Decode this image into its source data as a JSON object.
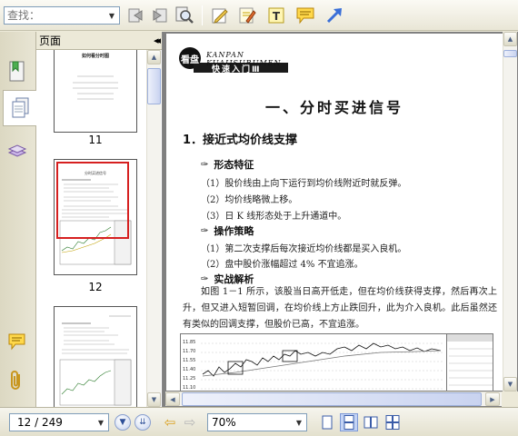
{
  "toolbar": {
    "find_placeholder": "查找：",
    "icons": [
      "prev-find-icon",
      "next-find-icon",
      "zoom-search-icon",
      "pencil-tool-icon",
      "highlight-tool-icon",
      "text-tool-icon",
      "note-tool-icon",
      "arrow-tool-icon"
    ]
  },
  "sidebar": {
    "panel_title": "页面",
    "collapse_glyph": "◂◂",
    "tabs": [
      "pages-tab",
      "bookmarks-tab",
      "layers-tab",
      "comments-tab",
      "attachments-tab"
    ],
    "thumbnails": [
      {
        "label": "11",
        "heading": "如何看分时图"
      },
      {
        "label": "12",
        "heading": "分时买进信号",
        "selected": true
      },
      {
        "label": "",
        "heading": ""
      }
    ]
  },
  "document": {
    "logo_sub": "KANPAN KUAIJSURUMEN",
    "logo_main": "快速入门Ⅲ",
    "logo_mark": "看盘",
    "title": "一、分时买进信号",
    "section": "1．接近式均价线支撑",
    "sub1": "形态特征",
    "lines1": [
      "（1）股价线由上向下运行到均价线附近时就反弹。",
      "（2）均价线略微上移。",
      "（3）日 K 线形态处于上升通道中。"
    ],
    "sub2": "操作策略",
    "lines2": [
      "（1）第二次支撑后每次接近均价线都是买入良机。",
      "（2）盘中股价涨幅超过 4% 不宜追涨。"
    ],
    "sub3": "实战解析",
    "paragraph": "如图 1－1 所示，该股当日高开低走，但在均价线获得支撑，然后再次上升，但又进入短暂回调，在均价线上方止跌回升，此为介入良机。此后虽然还有类似的回调支撑，但股价已高，不宜追涨。",
    "chart_ticks": [
      "11.85",
      "11.70",
      "11.55",
      "11.40",
      "11.25",
      "11.10"
    ]
  },
  "statusbar": {
    "page_value": "12 / 249",
    "zoom_value": "70%"
  },
  "colors": {
    "selection": "#d62020",
    "accent": "#2e4f98"
  }
}
